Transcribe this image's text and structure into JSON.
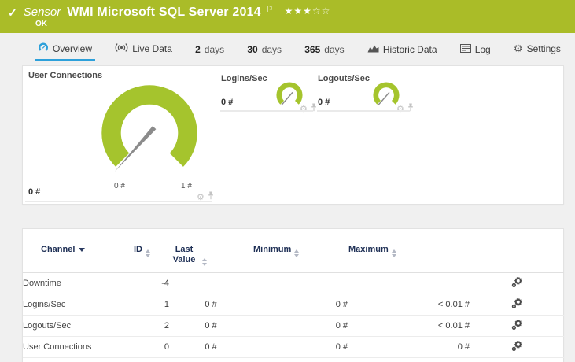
{
  "header": {
    "check_icon": "✓",
    "kind_label": "Sensor",
    "title": "WMI Microsoft SQL Server 2014",
    "flag_icon": "⚐",
    "stars": "★★★☆☆",
    "status": "OK",
    "bg_color": "#aabc28"
  },
  "tabs": {
    "overview": {
      "label": "Overview",
      "active": true
    },
    "live_data": {
      "label": "Live Data"
    },
    "days2": {
      "num": "2",
      "unit": "days"
    },
    "days30": {
      "num": "30",
      "unit": "days"
    },
    "days365": {
      "num": "365",
      "unit": "days"
    },
    "historic": {
      "label": "Historic Data"
    },
    "log": {
      "label": "Log"
    },
    "settings": {
      "label": "Settings",
      "gear_glyph": "⚙"
    },
    "accent_color": "#2da0da"
  },
  "gauges": {
    "gauge_color": "#a5c42d",
    "needle_color": "#8b8b8b",
    "primary": {
      "title": "User Connections",
      "value": "0 #",
      "scale_min": "0 #",
      "scale_max": "1 #",
      "gear_glyph": "⚙"
    },
    "logins": {
      "title": "Logins/Sec",
      "value": "0 #",
      "gear_glyph": "⚙"
    },
    "logouts": {
      "title": "Logouts/Sec",
      "value": "0 #",
      "gear_glyph": "⚙"
    }
  },
  "channel_table": {
    "columns": {
      "channel": "Channel",
      "id": "ID",
      "last_value": "Last Value",
      "minimum": "Minimum",
      "maximum": "Maximum"
    },
    "rows": [
      {
        "channel": "Downtime",
        "id": "-4",
        "last_value": "",
        "minimum": "",
        "maximum": ""
      },
      {
        "channel": "Logins/Sec",
        "id": "1",
        "last_value": "0 #",
        "minimum": "0 #",
        "maximum": "< 0.01 #"
      },
      {
        "channel": "Logouts/Sec",
        "id": "2",
        "last_value": "0 #",
        "minimum": "0 #",
        "maximum": "< 0.01 #"
      },
      {
        "channel": "User Connections",
        "id": "0",
        "last_value": "0 #",
        "minimum": "0 #",
        "maximum": "0 #"
      }
    ]
  }
}
